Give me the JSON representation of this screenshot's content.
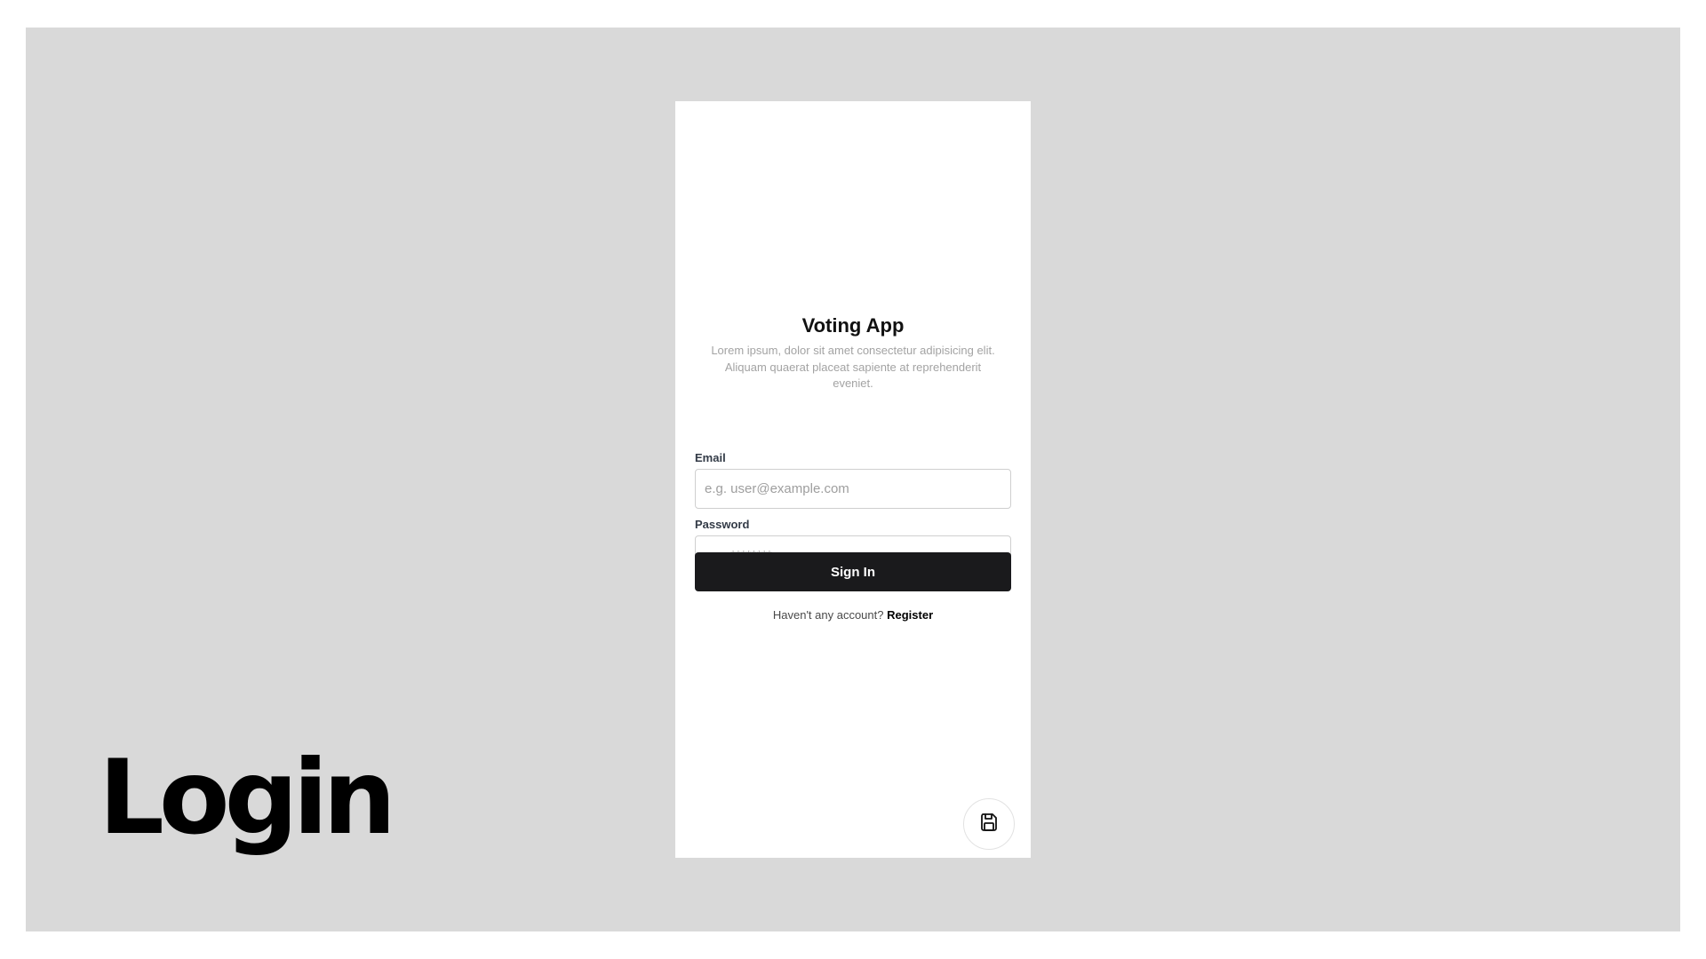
{
  "slide": {
    "label": "Login"
  },
  "app": {
    "title": "Voting App",
    "description": "Lorem ipsum, dolor sit amet consectetur adipisicing elit. Aliquam quaerat placeat sapiente at reprehenderit eveniet."
  },
  "form": {
    "email_label": "Email",
    "email_placeholder": "e.g. user@example.com",
    "password_label": "Password",
    "password_placeholder": "e.g. ********",
    "submit_label": "Sign In"
  },
  "register": {
    "prompt": "Haven't any account?",
    "link_label": "Register"
  },
  "fab": {
    "icon": "save-icon"
  },
  "colors": {
    "background": "#d9d9d9",
    "card": "#ffffff",
    "primary_button": "#1a1a1c",
    "muted_text": "#a3a3a3"
  }
}
